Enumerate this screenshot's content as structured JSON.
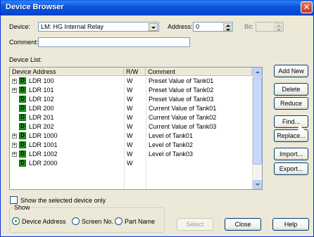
{
  "window": {
    "title": "Device Browser",
    "close_glyph": "✕"
  },
  "device": {
    "label": "Device:",
    "value": "LM: HG Internal Relay"
  },
  "address": {
    "label": "Address:",
    "value": "0"
  },
  "bit": {
    "label": "Bit:"
  },
  "comment": {
    "label": "Comment:",
    "value": ""
  },
  "device_list": {
    "label": "Device List:",
    "columns": [
      "Device Address",
      "R/W",
      "Comment"
    ],
    "rows": [
      {
        "expand": "+",
        "icon": "D",
        "address": "LDR 100",
        "rw": "W",
        "comment": "Preset Value of Tank01"
      },
      {
        "expand": "+",
        "icon": "D",
        "address": "LDR 101",
        "rw": "W",
        "comment": "Preset Value of Tank02"
      },
      {
        "expand": "",
        "icon": "D",
        "address": "LDR 102",
        "rw": "W",
        "comment": "Preset Value of Tank03"
      },
      {
        "expand": "",
        "icon": "D",
        "address": "LDR 200",
        "rw": "W",
        "comment": "Current Value of Tank01"
      },
      {
        "expand": "",
        "icon": "D",
        "address": "LDR 201",
        "rw": "W",
        "comment": "Current Value of Tank02"
      },
      {
        "expand": "",
        "icon": "D",
        "address": "LDR 202",
        "rw": "W",
        "comment": "Current Value of Tank03"
      },
      {
        "expand": "+",
        "icon": "D",
        "address": "LDR 1000",
        "rw": "W",
        "comment": "Level of Tank01"
      },
      {
        "expand": "+",
        "icon": "D",
        "address": "LDR 1001",
        "rw": "W",
        "comment": "Level of Tank02"
      },
      {
        "expand": "+",
        "icon": "D",
        "address": "LDR 1002",
        "rw": "W",
        "comment": "Level of Tank03"
      },
      {
        "expand": "",
        "icon": "D",
        "address": "LDR 2000",
        "rw": "W",
        "comment": ""
      }
    ]
  },
  "side_buttons": {
    "add_new": "Add New",
    "delete": "Delete",
    "reduce": "Reduce",
    "find": "Find...",
    "replace": "Replace...",
    "import": "Import...",
    "export": "Export..."
  },
  "show_selected": {
    "label": "Show the selected device only",
    "checked": false
  },
  "show_group": {
    "title": "Show",
    "options": [
      "Device Address",
      "Screen No.",
      "Part Name"
    ],
    "selected": "Device Address"
  },
  "bottom_buttons": {
    "select": "Select",
    "close": "Close",
    "help": "Help"
  }
}
